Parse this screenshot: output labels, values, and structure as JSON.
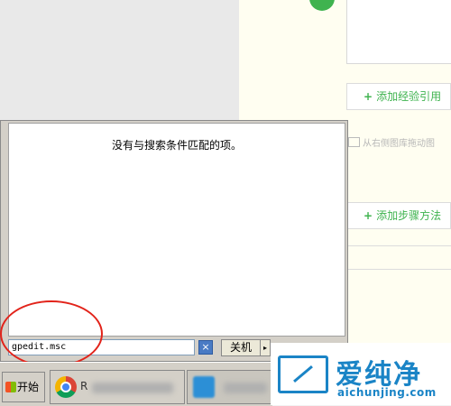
{
  "editor": {
    "add_experience_ref": "添加经验引用",
    "image_hint": "从右侧图库拖动图",
    "add_step_method": "添加步骤方法",
    "accent_color": "#3fb34f"
  },
  "start_menu": {
    "no_results_text": "没有与搜索条件匹配的项。",
    "search_value": "gpedit.msc",
    "shutdown_label": "关机",
    "shutdown_arrow": "▸",
    "clear_icon": "×"
  },
  "taskbar": {
    "start_label": "开始",
    "chrome_label": "R"
  },
  "watermark": {
    "title": "爱纯净",
    "url": "aichunjing.com",
    "color": "#1a84c6"
  },
  "annotation": {
    "ring_color": "#e2231a"
  }
}
